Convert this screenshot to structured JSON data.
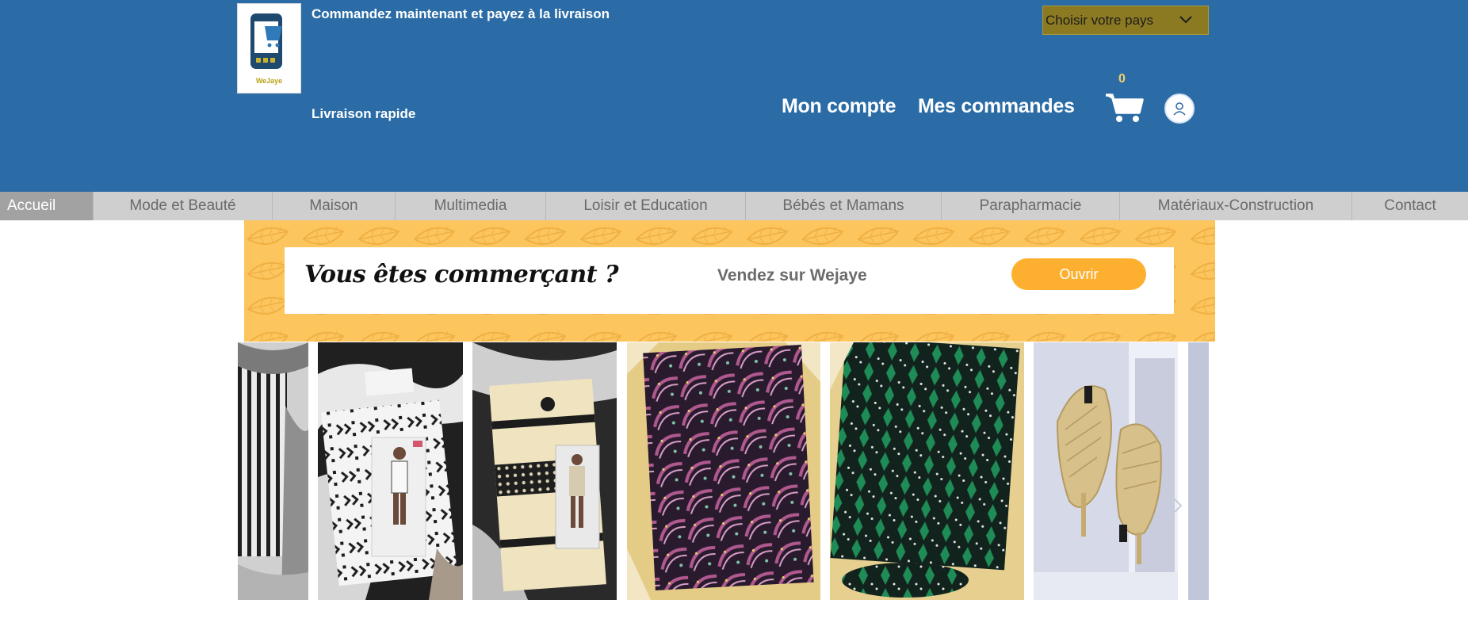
{
  "header": {
    "brand_name": "WeJaye",
    "tagline": "Commandez maintenant et payez à la livraison",
    "delivery": "Livraison rapide",
    "country_select": {
      "selected": "Choisir votre pays"
    },
    "links": {
      "account": "Mon compte",
      "orders": "Mes commandes"
    },
    "cart_count": "0",
    "colors": {
      "background": "#2b6ca6",
      "accent": "#f3d06c"
    }
  },
  "menu": {
    "items": [
      {
        "label": "Accueil",
        "active": true
      },
      {
        "label": "Mode et Beauté"
      },
      {
        "label": "Maison"
      },
      {
        "label": "Multimedia"
      },
      {
        "label": "Loisir et Education"
      },
      {
        "label": "Bébés et Mamans"
      },
      {
        "label": "Parapharmacie"
      },
      {
        "label": "Matériaux-Construction"
      },
      {
        "label": "Contact"
      }
    ]
  },
  "promo": {
    "title": "Vous êtes commerçant ?",
    "subtitle": "Vendez sur Wejaye",
    "button": "Ouvrir",
    "colors": {
      "background": "#fdc55d",
      "button": "#fdb02f"
    }
  },
  "gallery": {
    "icons": [
      "chevron-right-icon"
    ]
  }
}
